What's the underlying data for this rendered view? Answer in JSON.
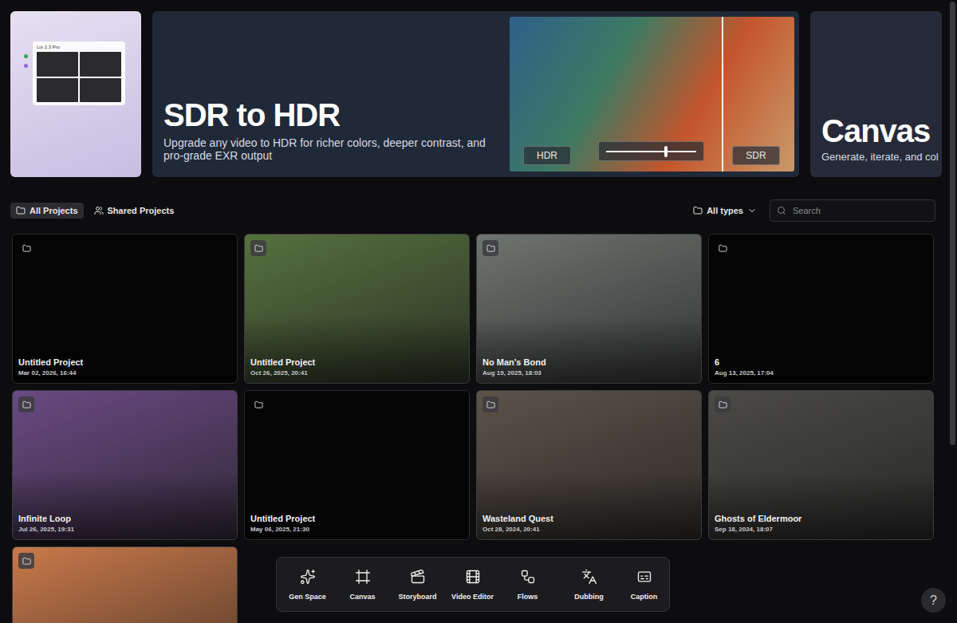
{
  "carousel": {
    "left_card": {
      "panel_label": "Ltx 2.3 Pro"
    },
    "hero": {
      "title": "SDR to HDR",
      "description": "Upgrade any video to HDR for richer colors, deeper contrast, and pro-grade EXR output",
      "compare": {
        "left_label": "HDR",
        "right_label": "SDR",
        "level": 0.66,
        "color": "#3d7a62"
      }
    },
    "right_card": {
      "title": "Canvas",
      "description": "Generate, iterate, and col"
    }
  },
  "tabs": [
    {
      "label": "All Projects",
      "selected": true
    },
    {
      "label": "Shared Projects",
      "selected": false
    }
  ],
  "filter": {
    "label": "All types"
  },
  "search": {
    "placeholder": "Search"
  },
  "projects": [
    {
      "kind": "empty",
      "name": "Untitled Project",
      "date": "Mar 02, 2026, 16:44"
    },
    {
      "kind": "image",
      "color": "#56703e",
      "name": "Untitled Project",
      "date": "Oct 26, 2025, 20:41"
    },
    {
      "kind": "image",
      "color": "#6e7470",
      "name": "No Man's Bond",
      "date": "Aug 19, 2025, 18:03"
    },
    {
      "kind": "empty",
      "name": "6",
      "date": "Aug 13, 2025, 17:04"
    },
    {
      "kind": "image",
      "color": "#6a4a82",
      "name": "Infinite Loop",
      "date": "Jul 26, 2025, 19:31"
    },
    {
      "kind": "empty",
      "name": "Untitled Project",
      "date": "May 06, 2025, 21:30"
    },
    {
      "kind": "image",
      "color": "#5c5249",
      "name": "Wasteland Quest",
      "date": "Oct 28, 2024, 20:41"
    },
    {
      "kind": "image",
      "color": "#4b4a47",
      "name": "Ghosts of Eldermoor",
      "date": "Sep 18, 2024, 18:07"
    },
    {
      "kind": "image",
      "color": "#c9794a",
      "name": "",
      "date": ""
    }
  ],
  "toolbar": {
    "groups": [
      [
        {
          "label": "Gen Space"
        },
        {
          "label": "Canvas"
        },
        {
          "label": "Storyboard"
        },
        {
          "label": "Video Editor"
        },
        {
          "label": "Flows"
        }
      ],
      [
        {
          "label": "Dubbing"
        },
        {
          "label": "Caption"
        }
      ]
    ]
  },
  "help": {
    "label": "?"
  }
}
